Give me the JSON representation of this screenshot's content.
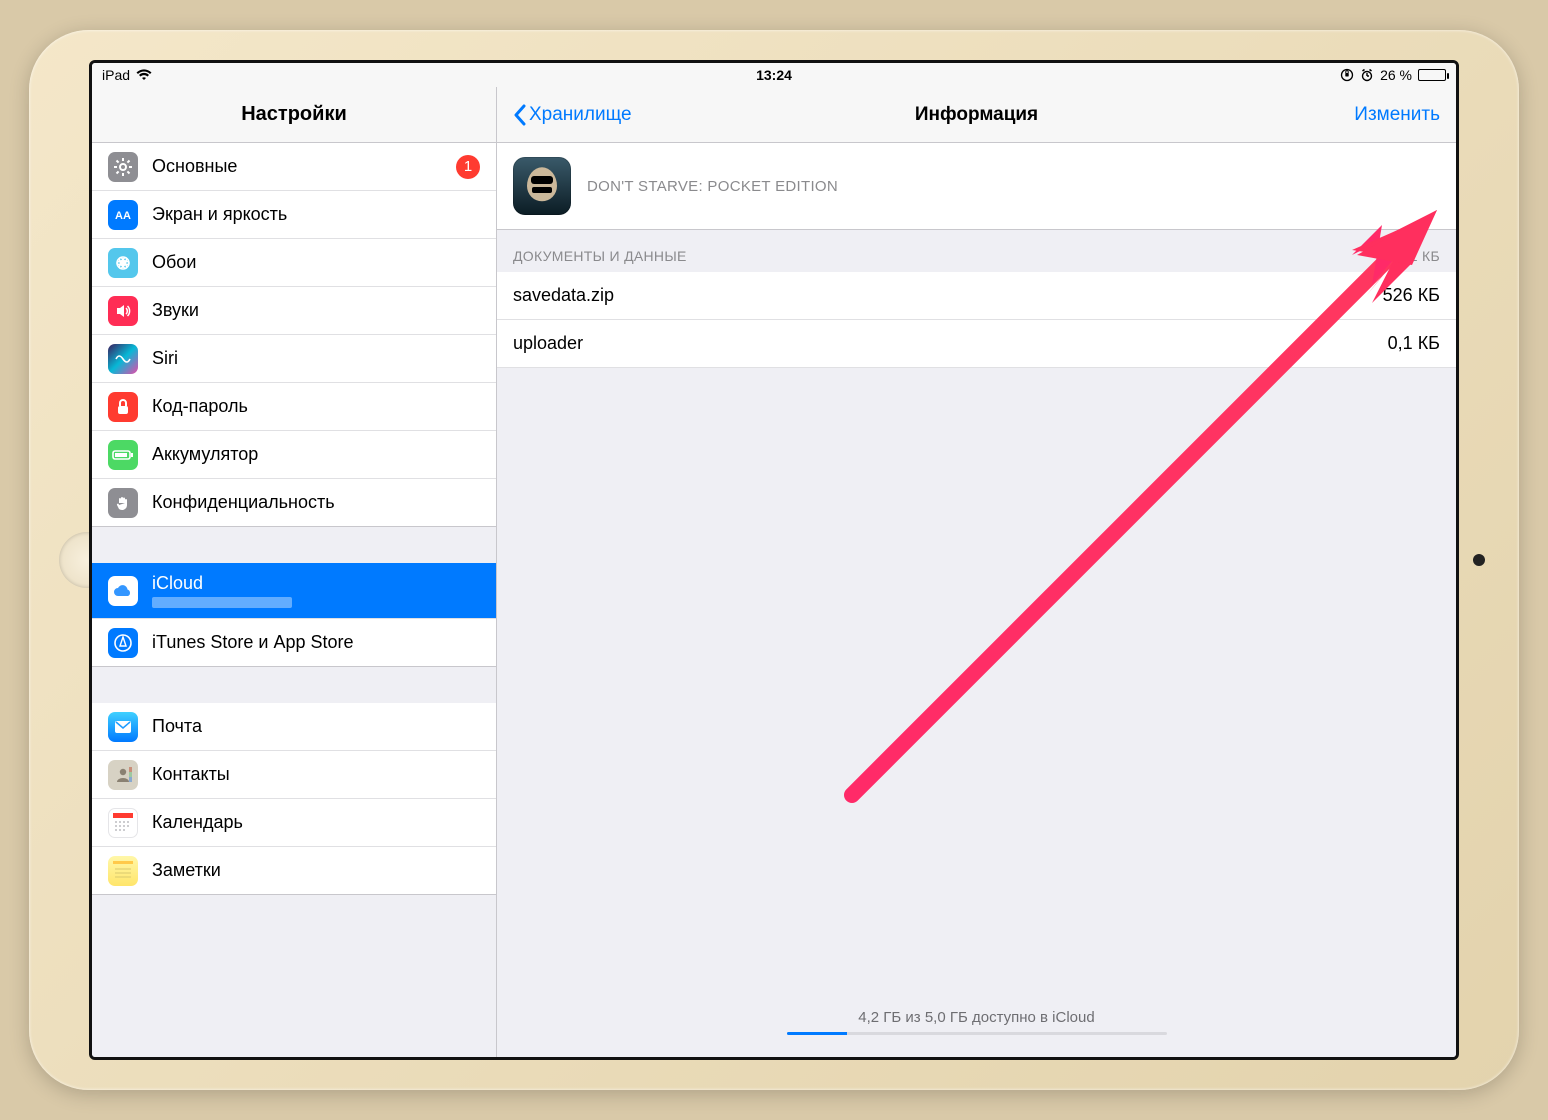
{
  "statusbar": {
    "device": "iPad",
    "time": "13:24",
    "battery_percent": "26 %"
  },
  "sidebar": {
    "title": "Настройки",
    "groups": [
      {
        "items": [
          {
            "label": "Основные",
            "badge": "1"
          },
          {
            "label": "Экран и яркость"
          },
          {
            "label": "Обои"
          },
          {
            "label": "Звуки"
          },
          {
            "label": "Siri"
          },
          {
            "label": "Код-пароль"
          },
          {
            "label": "Аккумулятор"
          },
          {
            "label": "Конфиденциальность"
          }
        ]
      },
      {
        "items": [
          {
            "label": "iCloud",
            "selected": true
          },
          {
            "label": "iTunes Store и App Store"
          }
        ]
      },
      {
        "items": [
          {
            "label": "Почта"
          },
          {
            "label": "Контакты"
          },
          {
            "label": "Календарь"
          },
          {
            "label": "Заметки"
          }
        ]
      }
    ]
  },
  "detail": {
    "back_label": "Хранилище",
    "title": "Информация",
    "edit_label": "Изменить",
    "app_name": "DON'T STARVE: POCKET EDITION",
    "section_header": "ДОКУМЕНТЫ И ДАННЫЕ",
    "section_total": "526,1 КБ",
    "files": [
      {
        "name": "savedata.zip",
        "size": "526 КБ"
      },
      {
        "name": "uploader",
        "size": "0,1 КБ"
      }
    ],
    "storage_text": "4,2 ГБ из 5,0 ГБ доступно в iCloud"
  }
}
